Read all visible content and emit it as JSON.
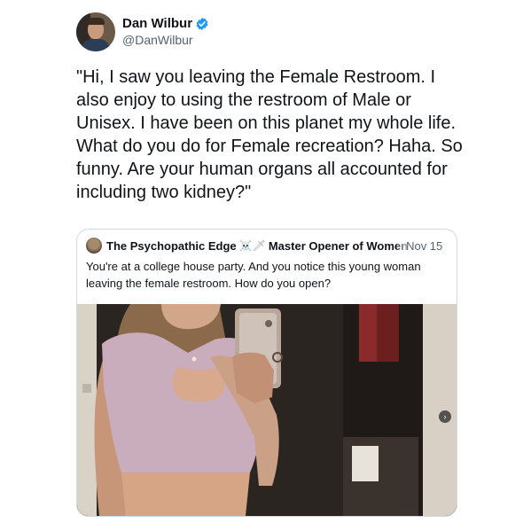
{
  "tweet": {
    "author": {
      "display_name": "Dan Wilbur",
      "handle": "@DanWilbur",
      "verified": true
    },
    "text": "\"Hi, I saw you leaving the Female Restroom. I also enjoy to using the restroom of Male or Unisex. I have been on this planet my whole life. What do you do for Female recreation? Haha. So funny. Are your human organs all accounted for including two kidney?\""
  },
  "quoted_tweet": {
    "author": {
      "display_name": "The Psychopathic Edge",
      "emoji": "☠️🗡",
      "title": "Master Opener of Women",
      "date": "Nov 15"
    },
    "text": "You're at a college house party. And you notice this young woman leaving the female restroom. How do you open?",
    "media": {
      "next_icon": "chevron-right-icon"
    }
  },
  "colors": {
    "verified_badge": "#1d9bf0",
    "secondary_text": "#536471",
    "border": "#cfd9de"
  }
}
